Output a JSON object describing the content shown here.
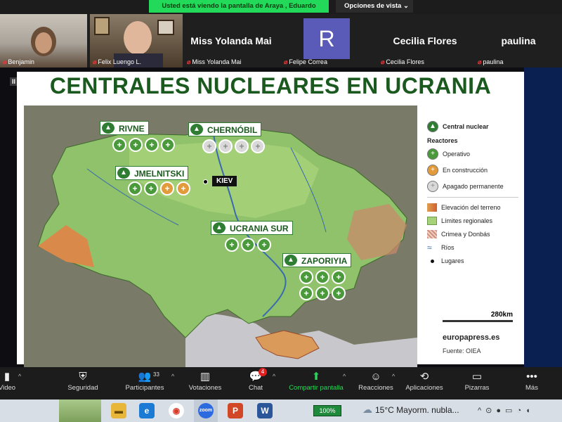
{
  "share_banner": {
    "viewing_text": "Usted está viendo la pantalla de Araya , Eduardo",
    "view_options": "Opciones de vista"
  },
  "participants": [
    {
      "name": "Benjamin",
      "muted": true,
      "kind": "video"
    },
    {
      "name": "Felix Luengo L.",
      "muted": true,
      "kind": "video"
    },
    {
      "name": "Miss Yolanda Mai",
      "display": "Miss Yolanda Mai",
      "muted": true,
      "kind": "name"
    },
    {
      "name": "Felipe Correa",
      "display": "R",
      "muted": true,
      "kind": "avatar"
    },
    {
      "name": "Cecilia Flores",
      "display": "Cecilia Flores",
      "muted": true,
      "kind": "name"
    },
    {
      "name": "paulina",
      "display": "paulina",
      "muted": true,
      "kind": "name"
    }
  ],
  "slide": {
    "title": "CENTRALES NUCLEARES EN UCRANIA",
    "plants": [
      {
        "name": "RIVNE",
        "reactors": [
          "op",
          "op",
          "op",
          "op"
        ]
      },
      {
        "name": "CHERNÓBIL",
        "reactors": [
          "off",
          "off",
          "off",
          "off"
        ]
      },
      {
        "name": "JMELNITSKI",
        "reactors": [
          "op",
          "op",
          "con",
          "con"
        ]
      },
      {
        "name": "UCRANIA SUR",
        "reactors": [
          "op",
          "op",
          "op"
        ]
      },
      {
        "name": "ZAPORIYIA",
        "reactors": [
          "op",
          "op",
          "op",
          "op",
          "op",
          "op"
        ]
      }
    ],
    "city": "KIEV",
    "legend": {
      "plant": "Central nuclear",
      "reactors_heading": "Reactores",
      "operative": "Operativo",
      "construction": "En construcción",
      "shutdown": "Apagado permanente",
      "elevation": "Elevación del terreno",
      "regional_limits": "Límites regionales",
      "crimea": "Crimea y Donbás",
      "rivers": "Ríos",
      "places": "Lugares"
    },
    "scale": "280km",
    "brand": "europapress.es",
    "source": "Fuente: OIEA",
    "colors": {
      "title": "#1b5a1e",
      "operative": "#4a9a3c",
      "construction": "#e29a3a",
      "shutdown": "#d9d9d9"
    }
  },
  "toolbar": {
    "video": "Video",
    "security": "Seguridad",
    "participants": "Participantes",
    "participants_count": "33",
    "polls": "Votaciones",
    "chat": "Chat",
    "chat_badge": "4",
    "share": "Compartir pantalla",
    "reactions": "Reacciones",
    "apps": "Aplicaciones",
    "whiteboards": "Pizarras",
    "more": "Más"
  },
  "taskbar": {
    "battery": "100%",
    "weather_temp": "15°C",
    "weather_text": "Mayorm. nubla..."
  }
}
